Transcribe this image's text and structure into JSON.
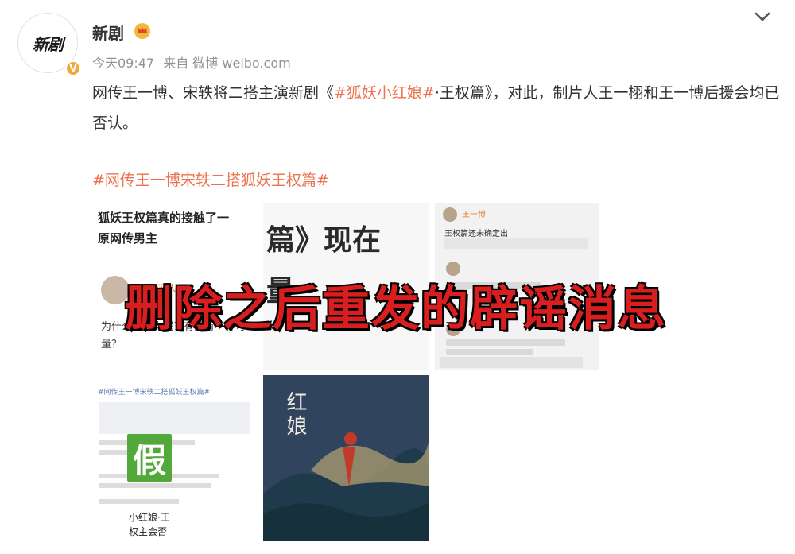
{
  "user": {
    "avatar_text": "新剧",
    "name": "新剧",
    "verified_badge": "V",
    "time": "今天09:47",
    "source": "来自 微博 weibo.com"
  },
  "post": {
    "text_pre": "网传王一博、宋轶将二搭主演新剧《",
    "hashtag": "#狐妖小红娘#",
    "text_post": "·王权篇》，对此，制片人王一栩和王一博后援会均已否认。",
    "topic": "#网传王一博宋轶二搭狐妖王权篇#"
  },
  "images": {
    "img1_title": "狐妖王权篇真的接触了一",
    "img1_subtitle": "原网传男主",
    "img1_name": "不是闲人",
    "img1_snippet": "为什么要骂人呢？有没有一种可量？",
    "img2_line1": "篇》现在",
    "img2_line2": "量 ·",
    "img3_name": "王一博",
    "img3_text": "王权篇还未确定出",
    "img4_header": "#网传王一博宋轶二搭狐妖王权篇#",
    "img4_quote": "小红娘·王\n权主会否\n是否",
    "fake_badge": "假",
    "img5_title": "红娘"
  },
  "overlay_caption": "删除之后重发的辟谣消息",
  "colors": {
    "hashtag": "#eb7350",
    "overlay": "#d81e1e",
    "verified": "#f3a63b",
    "fake_badge": "#52a83a"
  },
  "icons": {
    "expand": "chevron-down-icon",
    "crown": "crown-icon",
    "verified": "verified-icon"
  }
}
